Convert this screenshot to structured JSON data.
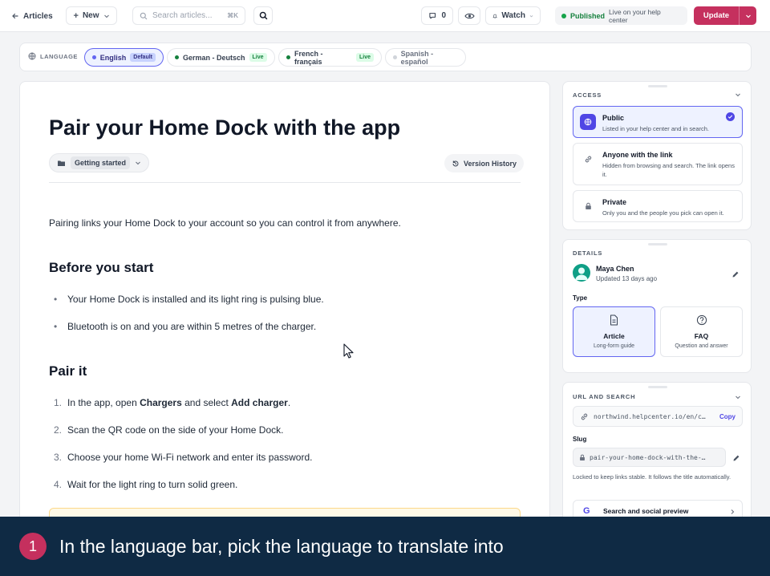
{
  "colors": {
    "accent": "#c5305e",
    "selected": "#6366f1",
    "live": "#15803d",
    "caption_bg": "#0f2a44"
  },
  "topbar": {
    "back_label": "Articles",
    "new_label": "New",
    "search_placeholder": "Search articles...",
    "search_shortcut": "⌘K",
    "comment_count": "0",
    "watch_label": "Watch",
    "status_label": "Published",
    "status_detail": "Live on your help center",
    "update_label": "Update"
  },
  "languages": {
    "label": "LANGUAGE",
    "items": [
      {
        "name": "English",
        "badge": "Default",
        "selected": true
      },
      {
        "name": "German - Deutsch",
        "badge": "Live"
      },
      {
        "name": "French - français",
        "badge": "Live"
      },
      {
        "name": "Spanish - español",
        "badge": ""
      }
    ]
  },
  "article": {
    "title": "Pair your Home Dock with the app",
    "collection": "Getting started",
    "version_history": "Version History",
    "intro": "Pairing links your Home Dock to your account so you can control it from anywhere.",
    "section1_heading": "Before you start",
    "section1_items": [
      "Your Home Dock is installed and its light ring is pulsing blue.",
      "Bluetooth is on and you are within 5 metres of the charger."
    ],
    "section2_heading": "Pair it",
    "section2_items": [
      {
        "num": "1.",
        "pre": "In the app, open ",
        "b1": "Chargers",
        "mid": " and select ",
        "b2": "Add charger",
        "post": "."
      },
      {
        "num": "2.",
        "text": "Scan the QR code on the side of your Home Dock."
      },
      {
        "num": "3.",
        "text": "Choose your home Wi-Fi network and enter its password."
      },
      {
        "num": "4.",
        "text": "Wait for the light ring to turn solid green."
      }
    ]
  },
  "access": {
    "title": "ACCESS",
    "options": [
      {
        "title": "Public",
        "desc": "Listed in your help center and in search.",
        "selected": true
      },
      {
        "title": "Anyone with the link",
        "desc": "Hidden from browsing and search. The link opens it."
      },
      {
        "title": "Private",
        "desc": "Only you and the people you pick can open it."
      }
    ]
  },
  "details": {
    "title": "DETAILS",
    "author": "Maya Chen",
    "updated": "Updated 13 days ago",
    "type_label": "Type",
    "types": [
      {
        "title": "Article",
        "desc": "Long-form guide",
        "selected": true
      },
      {
        "title": "FAQ",
        "desc": "Question and answer"
      }
    ]
  },
  "url_search": {
    "title": "URL AND SEARCH",
    "url": "northwind.helpcenter.io/en/c…",
    "copy_label": "Copy",
    "slug_label": "Slug",
    "slug": "pair-your-home-dock-with-the-…",
    "slug_note": "Locked to keep links stable. It follows the title automatically.",
    "seo_label": "Search and social preview"
  },
  "caption": {
    "step": "1",
    "text": "In the language bar, pick the language to translate into"
  }
}
